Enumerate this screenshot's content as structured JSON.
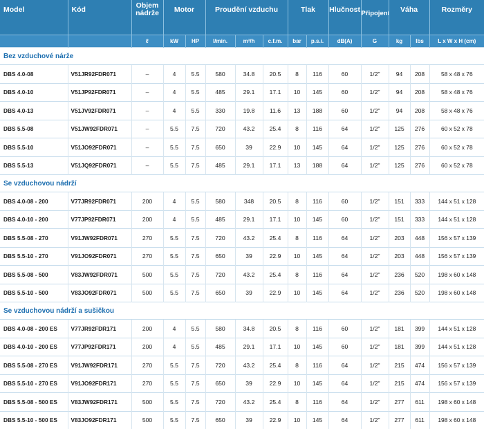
{
  "headers": {
    "model": "Model",
    "kod": "Kód",
    "objem": "Objem\nnádrže",
    "motor": "Motor",
    "prouzdeni": "Proudění vzduchu",
    "tlak": "Tlak",
    "hlucnost": "Hlučnost",
    "pripojeni": "Připojení",
    "vaha": "Váha",
    "rozmery": "Rozměry"
  },
  "units": [
    "ℓ",
    "kW",
    "HP",
    "l/min.",
    "m³/h",
    "c.f.m.",
    "bar",
    "p.s.i.",
    "dB(A)",
    "G",
    "kg",
    "lbs",
    "L x W x H (cm)"
  ],
  "sections": [
    {
      "title": "Bez vzduchové nárže",
      "rows": [
        [
          "DBS 4.0-08",
          "V51JR92FDR071",
          "–",
          "4",
          "5.5",
          "580",
          "34.8",
          "20.5",
          "8",
          "116",
          "60",
          "1/2\"",
          "94",
          "208",
          "58 x 48 x 76"
        ],
        [
          "DBS 4.0-10",
          "V51JP92FDR071",
          "–",
          "4",
          "5.5",
          "485",
          "29.1",
          "17.1",
          "10",
          "145",
          "60",
          "1/2\"",
          "94",
          "208",
          "58 x 48 x 76"
        ],
        [
          "DBS 4.0-13",
          "V51JV92FDR071",
          "–",
          "4",
          "5.5",
          "330",
          "19.8",
          "11.6",
          "13",
          "188",
          "60",
          "1/2\"",
          "94",
          "208",
          "58 x 48 x 76"
        ],
        [
          "DBS 5.5-08",
          "V51JW92FDR071",
          "–",
          "5.5",
          "7.5",
          "720",
          "43.2",
          "25.4",
          "8",
          "116",
          "64",
          "1/2\"",
          "125",
          "276",
          "60 x 52 x 78"
        ],
        [
          "DBS 5.5-10",
          "V51JO92FDR071",
          "–",
          "5.5",
          "7.5",
          "650",
          "39",
          "22.9",
          "10",
          "145",
          "64",
          "1/2\"",
          "125",
          "276",
          "60 x 52 x 78"
        ],
        [
          "DBS 5.5-13",
          "V51JQ92FDR071",
          "–",
          "5.5",
          "7.5",
          "485",
          "29.1",
          "17.1",
          "13",
          "188",
          "64",
          "1/2\"",
          "125",
          "276",
          "60 x 52 x 78"
        ]
      ]
    },
    {
      "title": "Se vzduchovou nádrží",
      "rows": [
        [
          "DBS 4.0-08 - 200",
          "V77JR92FDR071",
          "200",
          "4",
          "5.5",
          "580",
          "348",
          "20.5",
          "8",
          "116",
          "60",
          "1/2\"",
          "151",
          "333",
          "144 x 51 x 128"
        ],
        [
          "DBS 4.0-10 - 200",
          "V77JP92FDR071",
          "200",
          "4",
          "5.5",
          "485",
          "29.1",
          "17.1",
          "10",
          "145",
          "60",
          "1/2\"",
          "151",
          "333",
          "144 x 51 x 128"
        ],
        [
          "DBS 5.5-08 - 270",
          "V91JW92FDR071",
          "270",
          "5.5",
          "7.5",
          "720",
          "43.2",
          "25.4",
          "8",
          "116",
          "64",
          "1/2\"",
          "203",
          "448",
          "156 x 57 x 139"
        ],
        [
          "DBS 5.5-10 - 270",
          "V91JO92FDR071",
          "270",
          "5.5",
          "7.5",
          "650",
          "39",
          "22.9",
          "10",
          "145",
          "64",
          "1/2\"",
          "203",
          "448",
          "156 x 57 x 139"
        ],
        [
          "DBS 5.5-08 - 500",
          "V83JW92FDR071",
          "500",
          "5.5",
          "7.5",
          "720",
          "43.2",
          "25.4",
          "8",
          "116",
          "64",
          "1/2\"",
          "236",
          "520",
          "198 x 60 x 148"
        ],
        [
          "DBS 5.5-10 - 500",
          "V83JO92FDR071",
          "500",
          "5.5",
          "7.5",
          "650",
          "39",
          "22.9",
          "10",
          "145",
          "64",
          "1/2\"",
          "236",
          "520",
          "198 x 60 x 148"
        ]
      ]
    },
    {
      "title": "Se vzduchovou nádrží  a sušičkou",
      "rows": [
        [
          "DBS 4.0-08 - 200 ES",
          "V77JR92FDR171",
          "200",
          "4",
          "5.5",
          "580",
          "34.8",
          "20.5",
          "8",
          "116",
          "60",
          "1/2\"",
          "181",
          "399",
          "144 x 51 x 128"
        ],
        [
          "DBS 4.0-10 - 200 ES",
          "V77JP92FDR171",
          "200",
          "4",
          "5.5",
          "485",
          "29.1",
          "17.1",
          "10",
          "145",
          "60",
          "1/2\"",
          "181",
          "399",
          "144 x 51 x 128"
        ],
        [
          "DBS 5.5-08 - 270 ES",
          "V91JW92FDR171",
          "270",
          "5.5",
          "7.5",
          "720",
          "43.2",
          "25.4",
          "8",
          "116",
          "64",
          "1/2\"",
          "215",
          "474",
          "156 x 57 x 139"
        ],
        [
          "DBS 5.5-10 - 270 ES",
          "V91JO92FDR171",
          "270",
          "5.5",
          "7.5",
          "650",
          "39",
          "22.9",
          "10",
          "145",
          "64",
          "1/2\"",
          "215",
          "474",
          "156 x 57 x 139"
        ],
        [
          "DBS 5.5-08 - 500 ES",
          "V83JW92FDR171",
          "500",
          "5.5",
          "7.5",
          "720",
          "43.2",
          "25.4",
          "8",
          "116",
          "64",
          "1/2\"",
          "277",
          "611",
          "198 x 60 x 148"
        ],
        [
          "DBS 5.5-10 - 500 ES",
          "V83JO92FDR171",
          "500",
          "5.5",
          "7.5",
          "650",
          "39",
          "22.9",
          "10",
          "145",
          "64",
          "1/2\"",
          "277",
          "611",
          "198 x 60 x 148"
        ]
      ]
    }
  ]
}
